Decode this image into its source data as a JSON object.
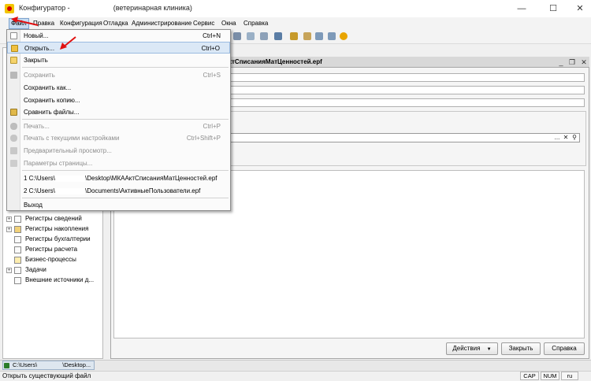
{
  "window": {
    "title": "Конфигуратор - ",
    "title_suffix": "(ветеринарная клиника)",
    "minimize": "—",
    "maximize": "☐",
    "close": "✕"
  },
  "menubar": {
    "items": [
      "Файл",
      "Правка",
      "Конфигурация",
      "Отладка",
      "Администрирование",
      "Сервис",
      "Окна",
      "Справка"
    ]
  },
  "file_menu": {
    "items": [
      {
        "label": "Новый...",
        "shortcut": "Ctrl+N"
      },
      {
        "label": "Открыть...",
        "shortcut": "Ctrl+O"
      },
      {
        "label": "Закрыть",
        "shortcut": ""
      },
      {
        "label": "Сохранить",
        "shortcut": "Ctrl+S"
      },
      {
        "label": "Сохранить как...",
        "shortcut": ""
      },
      {
        "label": "Сохранить копию...",
        "shortcut": ""
      },
      {
        "label": "Сравнить файлы...",
        "shortcut": ""
      },
      {
        "label": "Печать...",
        "shortcut": "Ctrl+P"
      },
      {
        "label": "Печать с текущими настройками",
        "shortcut": "Ctrl+Shift+P"
      },
      {
        "label": "Предварительный просмотр...",
        "shortcut": ""
      },
      {
        "label": "Параметры страницы...",
        "shortcut": ""
      },
      {
        "label": "1 C:\\Users\\",
        "label_tail": "\\Desktop\\МКААктСписанияМатЦенностей.epf",
        "shortcut": ""
      },
      {
        "label": "2 C:\\Users\\",
        "label_tail": "\\Documents\\АктивныеПользователи.epf",
        "shortcut": ""
      },
      {
        "label": "Выход",
        "shortcut": ""
      }
    ]
  },
  "document": {
    "title": "ктСписанияМатЦенностей.epf",
    "buttons": {
      "actions": "Действия",
      "close": "Закрыть",
      "help": "Справка"
    }
  },
  "tree": {
    "items": [
      "Регистры сведений",
      "Регистры накопления",
      "Регистры бухгалтерии",
      "Регистры расчета",
      "Бизнес-процессы",
      "Задачи",
      "Внешние источники д..."
    ]
  },
  "taskbar": {
    "item": "C:\\Users\\",
    "item_tail": "\\Desktop..."
  },
  "status": {
    "text": "Открыть существующий файл",
    "cap": "CAP",
    "num": "NUM",
    "lang": "ru"
  },
  "colors": {
    "menu_highlight": "#dbe8f6",
    "arrow": "#e01010"
  }
}
